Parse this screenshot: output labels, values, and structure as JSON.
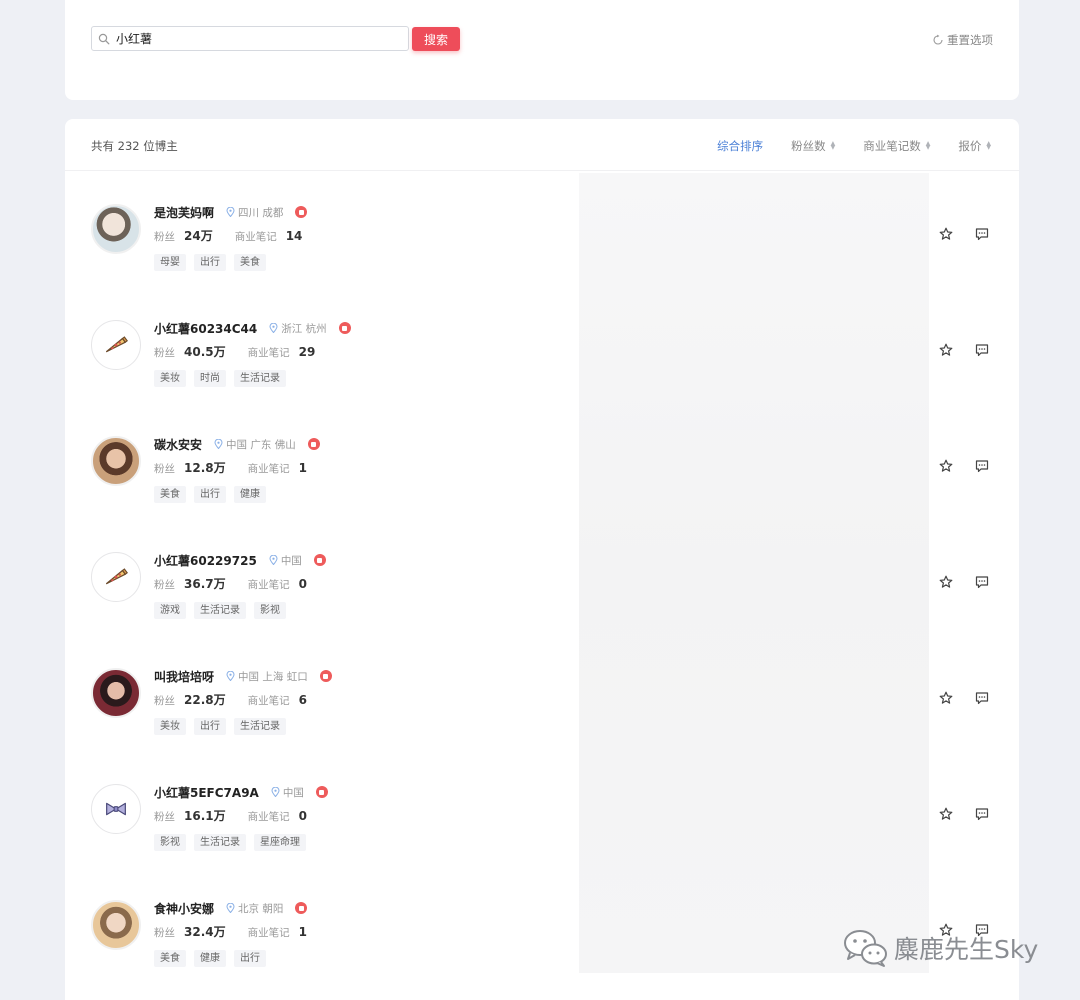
{
  "search": {
    "value": "小红薯",
    "button_label": "搜索",
    "reset_label": "重置选项"
  },
  "list": {
    "total_text": "共有 232 位博主",
    "sorts": [
      {
        "label": "综合排序",
        "active": true
      },
      {
        "label": "粉丝数",
        "active": false
      },
      {
        "label": "商业笔记数",
        "active": false
      },
      {
        "label": "报价",
        "active": false
      }
    ],
    "fans_label": "粉丝",
    "notes_label": "商业笔记",
    "bloggers": [
      {
        "name": "是泡芙妈啊",
        "location": "四川 成都",
        "fans": "24万",
        "notes": "14",
        "tags": [
          "母婴",
          "出行",
          "美食"
        ],
        "avatar": "photo-1"
      },
      {
        "name": "小红薯60234C44",
        "location": "浙江 杭州",
        "fans": "40.5万",
        "notes": "29",
        "tags": [
          "美妆",
          "时尚",
          "生活记录"
        ],
        "avatar": "pizza-icon"
      },
      {
        "name": "碳水安安",
        "location": "中国 广东 佛山",
        "fans": "12.8万",
        "notes": "1",
        "tags": [
          "美食",
          "出行",
          "健康"
        ],
        "avatar": "photo-2"
      },
      {
        "name": "小红薯60229725",
        "location": "中国",
        "fans": "36.7万",
        "notes": "0",
        "tags": [
          "游戏",
          "生活记录",
          "影视"
        ],
        "avatar": "pizza-icon"
      },
      {
        "name": "叫我培培呀",
        "location": "中国 上海 虹口",
        "fans": "22.8万",
        "notes": "6",
        "tags": [
          "美妆",
          "出行",
          "生活记录"
        ],
        "avatar": "photo-3"
      },
      {
        "name": "小红薯5EFC7A9A",
        "location": "中国",
        "fans": "16.1万",
        "notes": "0",
        "tags": [
          "影视",
          "生活记录",
          "星座命理"
        ],
        "avatar": "bow-icon"
      },
      {
        "name": "食神小安娜",
        "location": "北京 朝阳",
        "fans": "32.4万",
        "notes": "1",
        "tags": [
          "美食",
          "健康",
          "出行"
        ],
        "avatar": "photo-4"
      }
    ]
  },
  "watermark": {
    "text": "麋鹿先生Sky",
    "icon": "wechat-icon"
  },
  "colors": {
    "accent": "#ee4d5a",
    "active_sort": "#4a7fd6",
    "background": "#eef0f5"
  }
}
